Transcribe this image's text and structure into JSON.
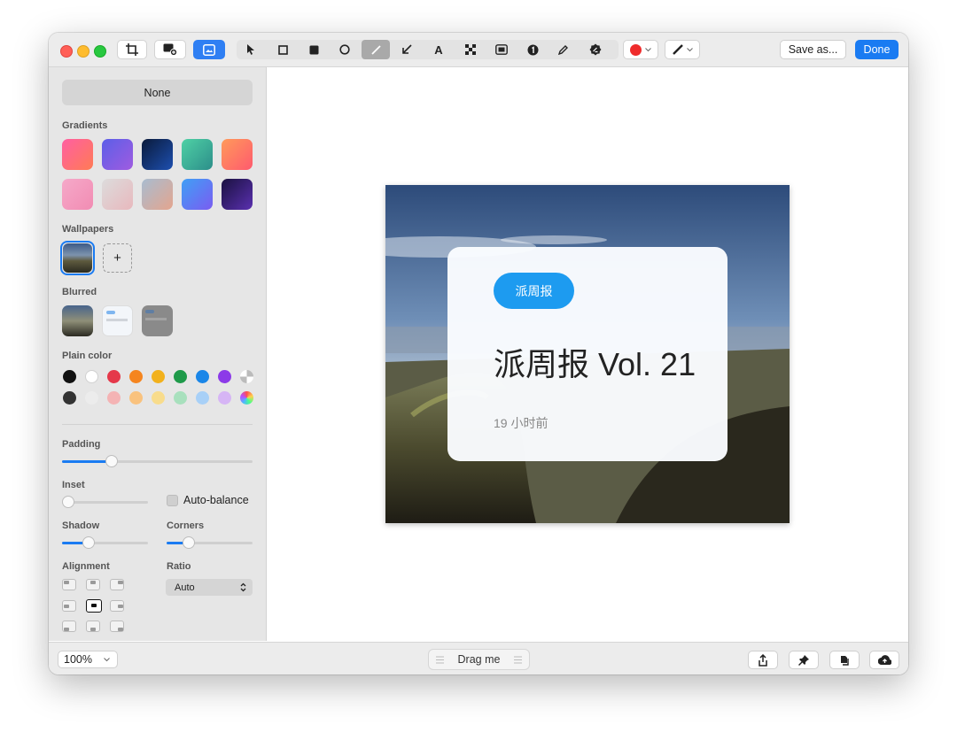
{
  "toolbar": {
    "save_label": "Save as...",
    "done_label": "Done",
    "color_accent": "#ef2b2b"
  },
  "sidebar": {
    "none_label": "None",
    "gradients_label": "Gradients",
    "wallpapers_label": "Wallpapers",
    "add_wallpaper": "+",
    "blurred_label": "Blurred",
    "plain_color_label": "Plain color",
    "padding_label": "Padding",
    "inset_label": "Inset",
    "auto_balance_label": "Auto-balance",
    "shadow_label": "Shadow",
    "corners_label": "Corners",
    "alignment_label": "Alignment",
    "ratio_label": "Ratio",
    "ratio_value": "Auto",
    "padding_level": 0.26,
    "inset_level": 0.0,
    "shadow_level": 0.31,
    "corners_level": 0.26,
    "selected_alignment": "center"
  },
  "card": {
    "tag": "派周报",
    "title": "派周报 Vol. 21",
    "time": "19 小时前"
  },
  "bottom": {
    "zoom": "100%",
    "drag": "Drag me"
  }
}
